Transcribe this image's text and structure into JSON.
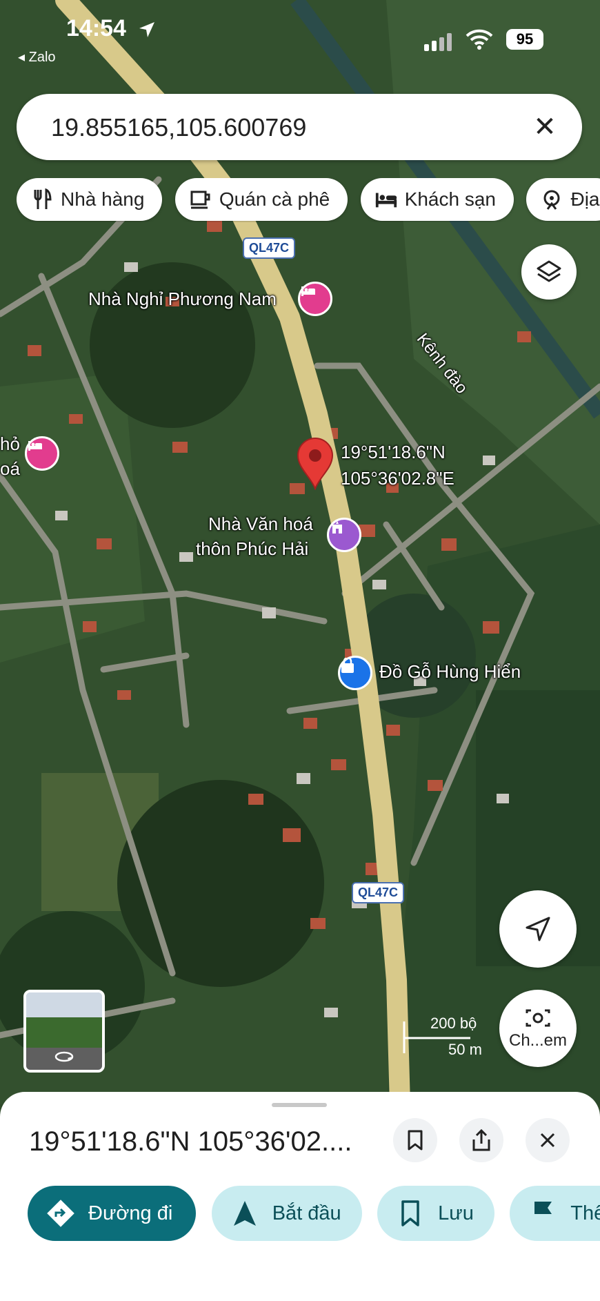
{
  "status_bar": {
    "time": "14:54",
    "back_app": "Zalo",
    "battery": "95"
  },
  "search": {
    "value": "19.855165,105.600769"
  },
  "chips": [
    {
      "label": "Nhà hàng",
      "icon": "restaurant-icon"
    },
    {
      "label": "Quán cà phê",
      "icon": "coffee-icon"
    },
    {
      "label": "Khách sạn",
      "icon": "hotel-icon"
    },
    {
      "label": "Địa",
      "icon": "attraction-icon"
    }
  ],
  "map": {
    "road_shield": "QL47C",
    "canal_label": "Kênh đào",
    "pin_label": {
      "line1": "19°51'18.6\"N",
      "line2": "105°36'02.8\"E"
    },
    "pois": {
      "guesthouse": "Nhà Nghỉ Phương Nam",
      "cultural_line1": "Nhà Văn hoá",
      "cultural_line2": "thôn Phúc Hải",
      "furniture": "Đồ Gỗ Hùng Hiển",
      "left_partial_line1": "hỏ",
      "left_partial_line2": "oá"
    },
    "scale": {
      "imperial": "200 bộ",
      "metric": "50 m"
    },
    "camera_label": "Ch...em"
  },
  "sheet": {
    "title": "19°51'18.6\"N 105°36'02....",
    "actions": [
      {
        "label": "Đường đi",
        "icon": "directions-icon"
      },
      {
        "label": "Bắt đầu",
        "icon": "navigate-icon"
      },
      {
        "label": "Lưu",
        "icon": "bookmark-icon"
      },
      {
        "label": "Thên",
        "icon": "flag-icon"
      }
    ]
  },
  "colors": {
    "primary": "#0b6e7a",
    "secondary": "#c8ecf0",
    "pin": "#e53935",
    "hotel": "#e23c8e",
    "culture": "#9b59d0",
    "shop": "#1a73e8"
  }
}
